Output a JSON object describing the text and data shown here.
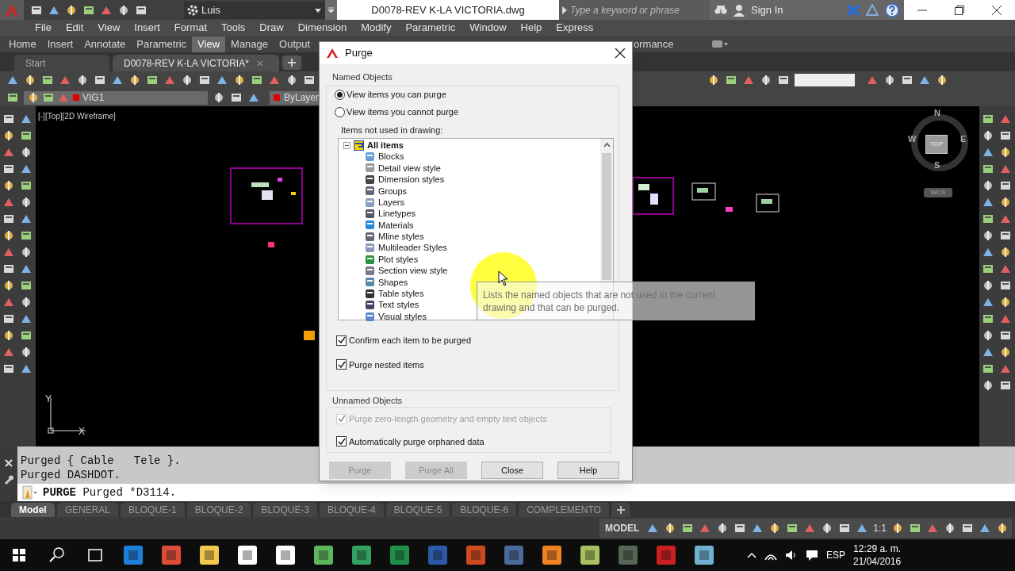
{
  "workspace": {
    "value": "Luis"
  },
  "window": {
    "title": "D0078-REV K-LA VICTORIA.dwg"
  },
  "search": {
    "placeholder": "Type a keyword or phrase"
  },
  "account": {
    "label": "Sign In"
  },
  "menu_bar": [
    "File",
    "Edit",
    "View",
    "Insert",
    "Format",
    "Tools",
    "Draw",
    "Dimension",
    "Modify",
    "Parametric",
    "Window",
    "Help",
    "Express"
  ],
  "ribbon_tabs": [
    {
      "label": "Home",
      "selected": false
    },
    {
      "label": "Insert",
      "selected": false
    },
    {
      "label": "Annotate",
      "selected": false
    },
    {
      "label": "Parametric",
      "selected": false
    },
    {
      "label": "View",
      "selected": true
    },
    {
      "label": "Manage",
      "selected": false
    },
    {
      "label": "Output",
      "selected": false
    },
    {
      "label": "ormance",
      "selected": false
    }
  ],
  "file_tabs": [
    {
      "label": "Start",
      "selected": false
    },
    {
      "label": "D0078-REV K-LA VICTORIA*",
      "selected": true
    }
  ],
  "layer_toolbar": {
    "layer": "VIG1",
    "property": "ByLayer"
  },
  "viewport": {
    "label": "[-][Top][2D Wireframe]"
  },
  "view_cube": {
    "north": "N",
    "south": "S",
    "east": "E",
    "west": "W",
    "face": "TOP",
    "ucs": "WCS"
  },
  "ucs_icon": {
    "x": "X",
    "y": "Y"
  },
  "command_history": [
    "Purged { Cable   Tele }.",
    "Purged DASHDOT."
  ],
  "command_line": {
    "command": "PURGE",
    "text": "Purged *D3114."
  },
  "layout_tabs": [
    {
      "label": "Model",
      "selected": true
    },
    {
      "label": "GENERAL",
      "selected": false
    },
    {
      "label": "BLOQUE-1",
      "selected": false
    },
    {
      "label": "BLOQUE-2",
      "selected": false
    },
    {
      "label": "BLOQUE-3",
      "selected": false
    },
    {
      "label": "BLOQUE-4",
      "selected": false
    },
    {
      "label": "BLOQUE-5",
      "selected": false
    },
    {
      "label": "BLOQUE-6",
      "selected": false
    },
    {
      "label": "COMPLEMENTO",
      "selected": false
    }
  ],
  "status_bar": {
    "mode": "MODEL",
    "scale": "1:1"
  },
  "taskbar": {
    "language": "ESP",
    "time": "12:29 a. m.",
    "date": "21/04/2016"
  },
  "dialog": {
    "title": "Purge",
    "named_objects": {
      "title": "Named Objects",
      "options": [
        {
          "label": "View items you can purge",
          "selected": true
        },
        {
          "label": "View items you cannot purge",
          "selected": false
        }
      ],
      "list_label": "Items not used in drawing:",
      "tree": {
        "label": "All items",
        "expanded": true,
        "children": [
          {
            "label": "Blocks"
          },
          {
            "label": "Detail view style"
          },
          {
            "label": "Dimension styles"
          },
          {
            "label": "Groups"
          },
          {
            "label": "Layers"
          },
          {
            "label": "Linetypes"
          },
          {
            "label": "Materials"
          },
          {
            "label": "Mline styles"
          },
          {
            "label": "Multileader Styles"
          },
          {
            "label": "Plot styles"
          },
          {
            "label": "Section view style"
          },
          {
            "label": "Shapes"
          },
          {
            "label": "Table styles"
          },
          {
            "label": "Text styles"
          },
          {
            "label": "Visual styles"
          }
        ]
      },
      "checkboxes": [
        {
          "label": "Confirm each item to be purged",
          "checked": true,
          "disabled": false
        },
        {
          "label": "Purge nested items",
          "checked": true,
          "disabled": false
        }
      ]
    },
    "unnamed_objects": {
      "title": "Unnamed Objects",
      "checkboxes": [
        {
          "label": "Purge zero-length geometry and empty text objects",
          "checked": true,
          "disabled": true
        },
        {
          "label": "Automatically purge orphaned data",
          "checked": true,
          "disabled": false
        }
      ]
    },
    "buttons": [
      {
        "label": "Purge",
        "disabled": true
      },
      {
        "label": "Purge All",
        "disabled": true
      },
      {
        "label": "Close",
        "disabled": false
      },
      {
        "label": "Help",
        "disabled": false
      }
    ]
  },
  "tooltip": {
    "text": "Lists the named objects that are not used in the current drawing and that can be purged."
  }
}
